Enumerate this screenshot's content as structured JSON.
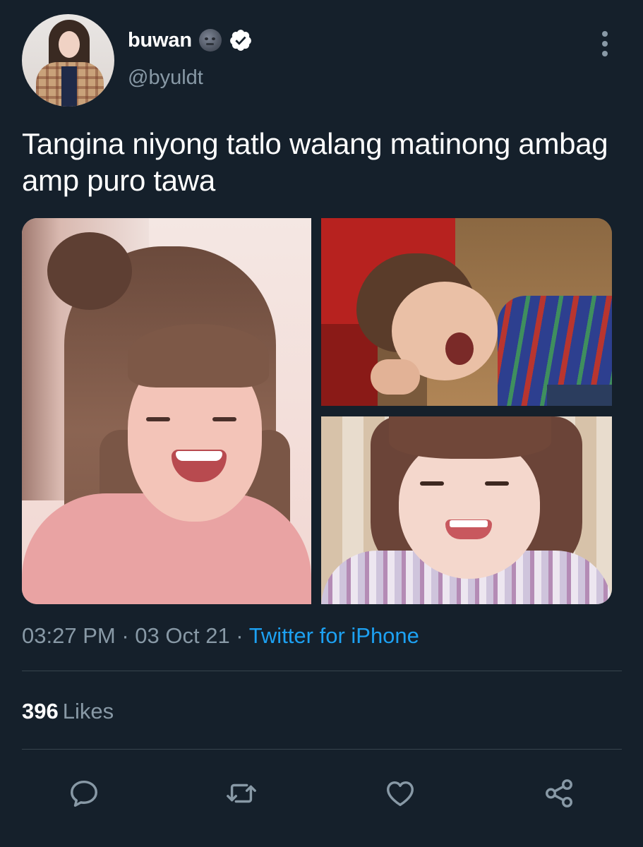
{
  "user": {
    "display_name": "buwan",
    "handle": "@byuldt",
    "name_emoji": "new-moon-face-emoji",
    "verified_icon": "verified-badge-icon"
  },
  "tweet": {
    "text": "Tangina niyong tatlo walang matinong ambag amp puro tawa",
    "time": "03:27 PM",
    "separator1": " · ",
    "date": "03 Oct 21",
    "separator2": " · ",
    "source": "Twitter for iPhone"
  },
  "stats": {
    "likes_count": "396",
    "likes_label": "Likes"
  },
  "actions": [
    {
      "name": "reply",
      "icon": "comment-icon"
    },
    {
      "name": "retweet",
      "icon": "retweet-icon"
    },
    {
      "name": "like",
      "icon": "heart-icon"
    },
    {
      "name": "share",
      "icon": "share-icon"
    }
  ],
  "colors": {
    "background": "#15202b",
    "secondary_text": "#8899a6",
    "link": "#1da1f2",
    "divider": "#38444d"
  }
}
